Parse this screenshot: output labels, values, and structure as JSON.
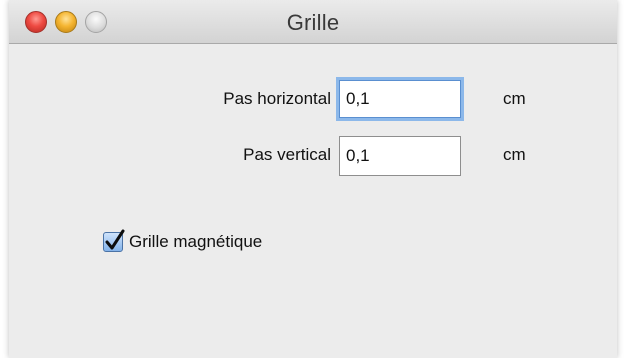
{
  "window": {
    "title": "Grille",
    "buttons": {
      "close": "close-icon",
      "minimize": "minimize-icon",
      "zoom": "zoom-icon"
    }
  },
  "form": {
    "horizontal": {
      "label": "Pas horizontal",
      "value": "0,1",
      "unit": "cm",
      "focused": true
    },
    "vertical": {
      "label": "Pas vertical",
      "value": "0,1",
      "unit": "cm"
    },
    "magnetic": {
      "label": "Grille magnétique",
      "checked": true
    }
  },
  "colors": {
    "window_bg": "#ececec",
    "focus_ring": "#8cb8ea",
    "checkbox_fill": "#84b3ea"
  }
}
